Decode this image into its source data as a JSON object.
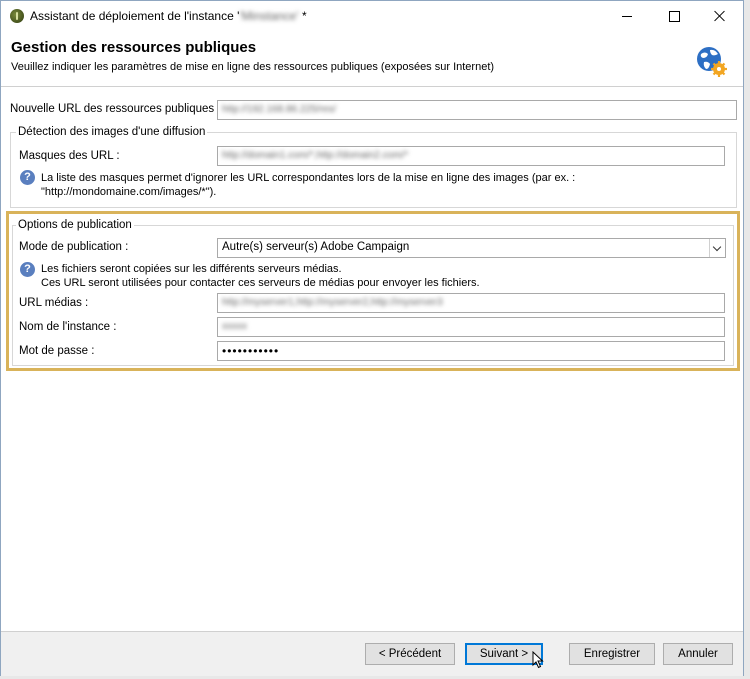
{
  "window": {
    "title_prefix": "Assistant de déploiement de l'instance '",
    "title_instance": "'Minstance'",
    "title_suffix": " *"
  },
  "header": {
    "title": "Gestion des ressources publiques",
    "subtitle": "Veuillez indiquer les paramètres de mise en ligne des ressources publiques (exposées sur Internet)",
    "icon": "globe-gear-icon"
  },
  "public_url": {
    "label": "Nouvelle URL des ressources publiques :",
    "value": "http://192.168.86.225/res/"
  },
  "image_detection": {
    "legend": "Détection des images d'une diffusion",
    "masks_label": "Masques des URL :",
    "masks_value": "http://domain1.com/*,http://domain2.com/*",
    "help_line1": "La liste des masques permet d'ignorer les URL correspondantes lors de la mise en ligne des images (par ex. :",
    "help_line2": "\"http://mondomaine.com/images/*\")."
  },
  "publication": {
    "legend": "Options de publication",
    "mode_label": "Mode de publication :",
    "mode_value": "Autre(s) serveur(s) Adobe Campaign",
    "help_line1": "Les fichiers seront copiées sur les différents serveurs médias.",
    "help_line2": "Ces URL seront utilisées pour contacter ces serveurs de médias pour envoyer les fichiers.",
    "media_urls_label": "URL médias :",
    "media_urls_value": "http://myserver1,http://myserver2,http://myserver3",
    "instance_label": "Nom de l'instance :",
    "instance_value": "xxxxx",
    "password_label": "Mot de passe :",
    "password_value": "•••••••••••"
  },
  "footer": {
    "previous": "< Précédent",
    "next": "Suivant >",
    "save": "Enregistrer",
    "cancel": "Annuler"
  },
  "colors": {
    "highlight_border": "#d9b35a",
    "help_icon": "#5a7fbf",
    "primary_button_border": "#0078d7"
  }
}
